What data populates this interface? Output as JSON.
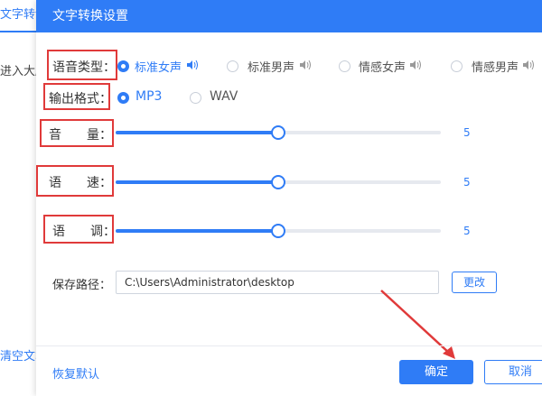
{
  "background_app": {
    "tab_label": "文字转语音",
    "text_snippet": "进入大脑",
    "clear_label": "清空文本"
  },
  "dialog": {
    "title": "文字转换设置",
    "accent_color": "#2f7cf6",
    "annotation_color": "#e03a3a"
  },
  "voice_type": {
    "label": "语音类型：",
    "options": [
      "标准女声",
      "标准男声",
      "情感女声",
      "情感男声"
    ],
    "selected": "标准女声"
  },
  "output_format": {
    "label": "输出格式：",
    "options": [
      "MP3",
      "WAV"
    ],
    "selected": "MP3"
  },
  "sliders": {
    "volume": {
      "label": "音　　量：",
      "value": "5",
      "fraction": 0.5
    },
    "speed": {
      "label": "语　　速：",
      "value": "5",
      "fraction": 0.5
    },
    "pitch": {
      "label": "语　　调：",
      "value": "5",
      "fraction": 0.5
    }
  },
  "save_path": {
    "label": "保存路径：",
    "value": "C:\\Users\\Administrator\\desktop",
    "change_label": "更改"
  },
  "footer": {
    "restore_label": "恢复默认",
    "ok_label": "确定",
    "cancel_label": "取消"
  },
  "icons": {
    "speaker": "speaker-icon",
    "arrow": "red-arrow-annotation"
  }
}
